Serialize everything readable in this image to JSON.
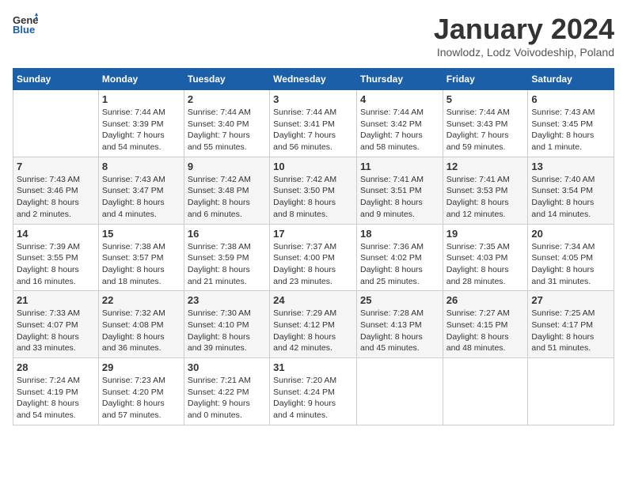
{
  "header": {
    "logo_line1": "General",
    "logo_line2": "Blue",
    "month": "January 2024",
    "location": "Inowlodz, Lodz Voivodeship, Poland"
  },
  "days_of_week": [
    "Sunday",
    "Monday",
    "Tuesday",
    "Wednesday",
    "Thursday",
    "Friday",
    "Saturday"
  ],
  "weeks": [
    [
      {
        "num": "",
        "info": ""
      },
      {
        "num": "1",
        "info": "Sunrise: 7:44 AM\nSunset: 3:39 PM\nDaylight: 7 hours\nand 54 minutes."
      },
      {
        "num": "2",
        "info": "Sunrise: 7:44 AM\nSunset: 3:40 PM\nDaylight: 7 hours\nand 55 minutes."
      },
      {
        "num": "3",
        "info": "Sunrise: 7:44 AM\nSunset: 3:41 PM\nDaylight: 7 hours\nand 56 minutes."
      },
      {
        "num": "4",
        "info": "Sunrise: 7:44 AM\nSunset: 3:42 PM\nDaylight: 7 hours\nand 58 minutes."
      },
      {
        "num": "5",
        "info": "Sunrise: 7:44 AM\nSunset: 3:43 PM\nDaylight: 7 hours\nand 59 minutes."
      },
      {
        "num": "6",
        "info": "Sunrise: 7:43 AM\nSunset: 3:45 PM\nDaylight: 8 hours\nand 1 minute."
      }
    ],
    [
      {
        "num": "7",
        "info": "Sunrise: 7:43 AM\nSunset: 3:46 PM\nDaylight: 8 hours\nand 2 minutes."
      },
      {
        "num": "8",
        "info": "Sunrise: 7:43 AM\nSunset: 3:47 PM\nDaylight: 8 hours\nand 4 minutes."
      },
      {
        "num": "9",
        "info": "Sunrise: 7:42 AM\nSunset: 3:48 PM\nDaylight: 8 hours\nand 6 minutes."
      },
      {
        "num": "10",
        "info": "Sunrise: 7:42 AM\nSunset: 3:50 PM\nDaylight: 8 hours\nand 8 minutes."
      },
      {
        "num": "11",
        "info": "Sunrise: 7:41 AM\nSunset: 3:51 PM\nDaylight: 8 hours\nand 9 minutes."
      },
      {
        "num": "12",
        "info": "Sunrise: 7:41 AM\nSunset: 3:53 PM\nDaylight: 8 hours\nand 12 minutes."
      },
      {
        "num": "13",
        "info": "Sunrise: 7:40 AM\nSunset: 3:54 PM\nDaylight: 8 hours\nand 14 minutes."
      }
    ],
    [
      {
        "num": "14",
        "info": "Sunrise: 7:39 AM\nSunset: 3:55 PM\nDaylight: 8 hours\nand 16 minutes."
      },
      {
        "num": "15",
        "info": "Sunrise: 7:38 AM\nSunset: 3:57 PM\nDaylight: 8 hours\nand 18 minutes."
      },
      {
        "num": "16",
        "info": "Sunrise: 7:38 AM\nSunset: 3:59 PM\nDaylight: 8 hours\nand 21 minutes."
      },
      {
        "num": "17",
        "info": "Sunrise: 7:37 AM\nSunset: 4:00 PM\nDaylight: 8 hours\nand 23 minutes."
      },
      {
        "num": "18",
        "info": "Sunrise: 7:36 AM\nSunset: 4:02 PM\nDaylight: 8 hours\nand 25 minutes."
      },
      {
        "num": "19",
        "info": "Sunrise: 7:35 AM\nSunset: 4:03 PM\nDaylight: 8 hours\nand 28 minutes."
      },
      {
        "num": "20",
        "info": "Sunrise: 7:34 AM\nSunset: 4:05 PM\nDaylight: 8 hours\nand 31 minutes."
      }
    ],
    [
      {
        "num": "21",
        "info": "Sunrise: 7:33 AM\nSunset: 4:07 PM\nDaylight: 8 hours\nand 33 minutes."
      },
      {
        "num": "22",
        "info": "Sunrise: 7:32 AM\nSunset: 4:08 PM\nDaylight: 8 hours\nand 36 minutes."
      },
      {
        "num": "23",
        "info": "Sunrise: 7:30 AM\nSunset: 4:10 PM\nDaylight: 8 hours\nand 39 minutes."
      },
      {
        "num": "24",
        "info": "Sunrise: 7:29 AM\nSunset: 4:12 PM\nDaylight: 8 hours\nand 42 minutes."
      },
      {
        "num": "25",
        "info": "Sunrise: 7:28 AM\nSunset: 4:13 PM\nDaylight: 8 hours\nand 45 minutes."
      },
      {
        "num": "26",
        "info": "Sunrise: 7:27 AM\nSunset: 4:15 PM\nDaylight: 8 hours\nand 48 minutes."
      },
      {
        "num": "27",
        "info": "Sunrise: 7:25 AM\nSunset: 4:17 PM\nDaylight: 8 hours\nand 51 minutes."
      }
    ],
    [
      {
        "num": "28",
        "info": "Sunrise: 7:24 AM\nSunset: 4:19 PM\nDaylight: 8 hours\nand 54 minutes."
      },
      {
        "num": "29",
        "info": "Sunrise: 7:23 AM\nSunset: 4:20 PM\nDaylight: 8 hours\nand 57 minutes."
      },
      {
        "num": "30",
        "info": "Sunrise: 7:21 AM\nSunset: 4:22 PM\nDaylight: 9 hours\nand 0 minutes."
      },
      {
        "num": "31",
        "info": "Sunrise: 7:20 AM\nSunset: 4:24 PM\nDaylight: 9 hours\nand 4 minutes."
      },
      {
        "num": "",
        "info": ""
      },
      {
        "num": "",
        "info": ""
      },
      {
        "num": "",
        "info": ""
      }
    ]
  ]
}
